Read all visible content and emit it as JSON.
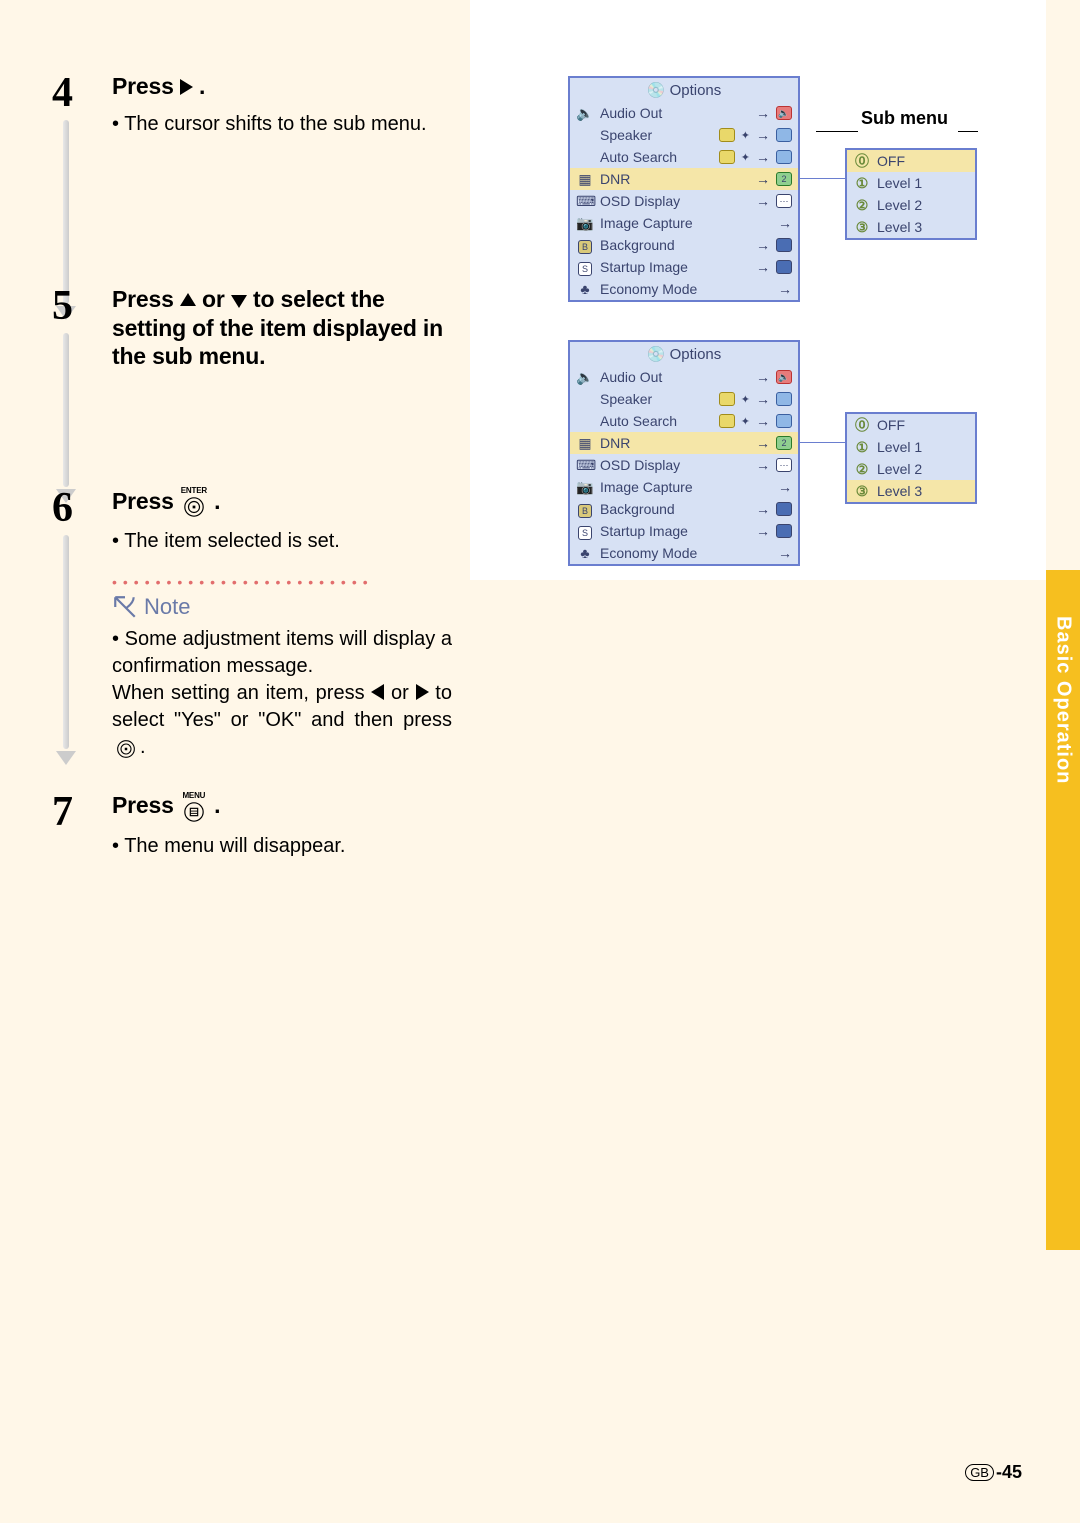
{
  "section_tab": "Basic Operation",
  "page_code": "GB",
  "page_number": "-45",
  "sub_menu_label": "Sub menu",
  "steps": {
    "s4": {
      "num": "4",
      "title_pre": "Press ",
      "title_post": " .",
      "desc": "The cursor shifts to the sub menu."
    },
    "s5": {
      "num": "5",
      "title_pre": "Press ",
      "title_mid": " or ",
      "title_post": " to select the setting of the item displayed in the sub menu."
    },
    "s6": {
      "num": "6",
      "title_pre": "Press ",
      "title_post": " .",
      "icon_label": "ENTER",
      "desc": "The item selected is set."
    },
    "s7": {
      "num": "7",
      "title_pre": "Press ",
      "title_post": " .",
      "icon_label": "MENU",
      "desc": "The menu will disappear."
    }
  },
  "note": {
    "label": "Note",
    "line1": "Some adjustment items will display a confirmation message.",
    "line2_pre": "When setting an item, press ",
    "line2_mid": " or ",
    "line2_post": " to select \"Yes\" or \"OK\" and then press ",
    "line2_end": "."
  },
  "osd": {
    "title": "Options",
    "items": [
      {
        "icon": "🔈",
        "label": "Audio Out",
        "val_icon": "red",
        "val": ""
      },
      {
        "icon": "",
        "label": "Speaker",
        "mid_icon": "yellow",
        "val_icon": "blue",
        "val": ""
      },
      {
        "icon": "",
        "label": "Auto Search",
        "mid_icon": "yellow",
        "val_icon": "blue",
        "val": ""
      },
      {
        "icon": "▦",
        "label": "DNR",
        "val_icon": "green",
        "val": "2",
        "hl": true
      },
      {
        "icon": "⌨",
        "label": "OSD Display",
        "val_icon": "plain",
        "val": ""
      },
      {
        "icon": "📷",
        "label": "Image Capture",
        "val_icon": "",
        "val": ""
      },
      {
        "icon": "B",
        "label": "Background",
        "val_icon": "bluefill",
        "val": ""
      },
      {
        "icon": "S",
        "label": "Startup Image",
        "val_icon": "bluefill",
        "val": ""
      },
      {
        "icon": "♣",
        "label": "Economy Mode",
        "val_icon": "",
        "val": ""
      }
    ],
    "sub": [
      {
        "n": "⓪",
        "label": "OFF"
      },
      {
        "n": "①",
        "label": "Level 1"
      },
      {
        "n": "②",
        "label": "Level 2"
      },
      {
        "n": "③",
        "label": "Level 3"
      }
    ]
  }
}
